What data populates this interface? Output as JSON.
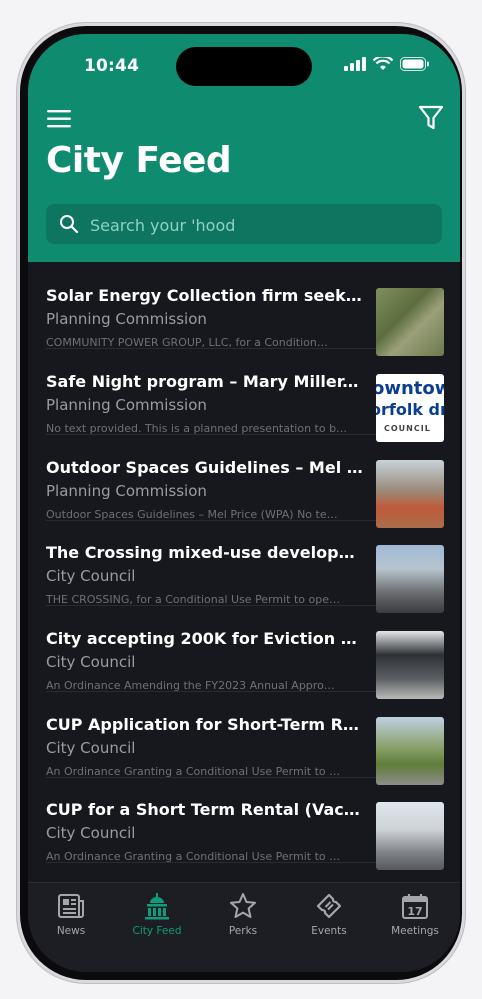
{
  "status_bar": {
    "time": "10:44"
  },
  "header": {
    "title": "City Feed",
    "search_placeholder": "Search your 'hood"
  },
  "feed": [
    {
      "title": "Solar Energy Collection firm seekin…",
      "source": "Planning Commission",
      "snippet": "COMMUNITY POWER GROUP, LLC, for a Condition…"
    },
    {
      "title": "Safe Night program – Mary Miller, …",
      "source": "Planning Commission",
      "snippet": "No text provided. This is a planned presentation to b…",
      "thumb_text": [
        "owntow",
        "orfolk dr",
        "COUNCIL"
      ]
    },
    {
      "title": "Outdoor Spaces Guidelines – Mel …",
      "source": "Planning Commission",
      "snippet": "Outdoor Spaces Guidelines – Mel Price (WPA) No te…"
    },
    {
      "title": "The Crossing mixed-use develop…",
      "source": "City Council",
      "snippet": "THE CROSSING, for a Conditional Use Permit to ope…"
    },
    {
      "title": "City accepting 200K for Eviction Re…",
      "source": "City Council",
      "snippet": "An Ordinance Amending the FY2023 Annual Appro…"
    },
    {
      "title": "CUP Application for Short-Term Re…",
      "source": "City Council",
      "snippet": "An Ordinance Granting a Conditional Use Permit to …"
    },
    {
      "title": "CUP for a Short Term Rental (Vaca…",
      "source": "City Council",
      "snippet": "An Ordinance Granting a Conditional Use Permit to …"
    }
  ],
  "tabs": [
    {
      "label": "News",
      "icon": "newspaper-icon",
      "active": false
    },
    {
      "label": "City Feed",
      "icon": "city-hall-icon",
      "active": true
    },
    {
      "label": "Perks",
      "icon": "star-icon",
      "active": false
    },
    {
      "label": "Events",
      "icon": "ticket-icon",
      "active": false
    },
    {
      "label": "Meetings",
      "icon": "calendar-icon",
      "active": false,
      "badge_text": "17"
    }
  ],
  "colors": {
    "header_bg": "#0f8c6f",
    "feed_bg": "#17181d",
    "active_tab": "#0f9c7b"
  }
}
